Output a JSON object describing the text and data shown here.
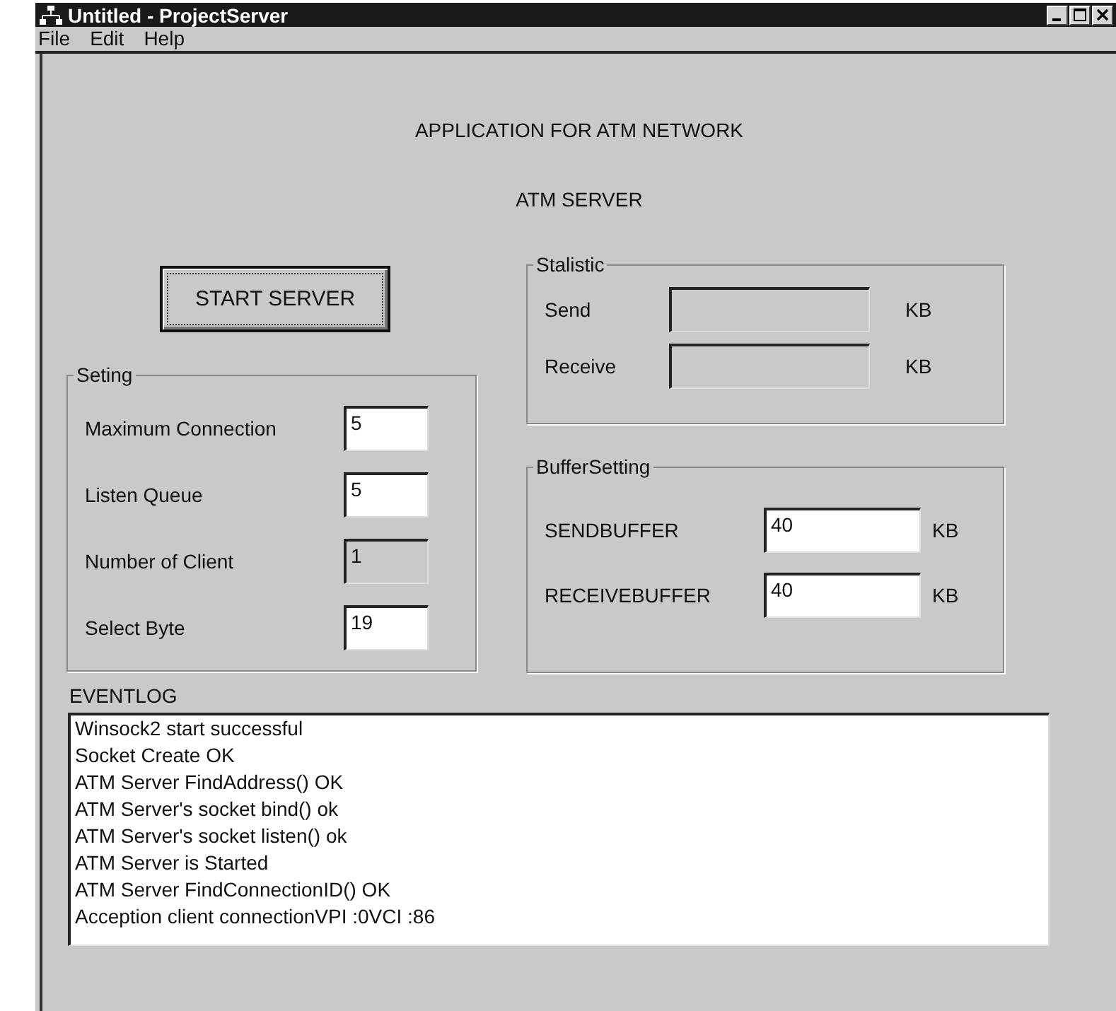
{
  "window": {
    "title": "Untitled - ProjectServer"
  },
  "menu": [
    {
      "label": "File"
    },
    {
      "label": "Edit"
    },
    {
      "label": "Help"
    }
  ],
  "heading": "APPLICATION FOR ATM NETWORK",
  "subheading": "ATM SERVER",
  "start_button": "START SERVER",
  "setting": {
    "title": "Seting",
    "rows": [
      {
        "label": "Maximum Connection",
        "value": "5",
        "disabled": false
      },
      {
        "label": "Listen Queue",
        "value": "5",
        "disabled": false
      },
      {
        "label": "Number of Client",
        "value": "1",
        "disabled": true
      },
      {
        "label": "Select Byte",
        "value": "19",
        "disabled": false
      }
    ]
  },
  "statistic": {
    "title": "Stalistic",
    "rows": [
      {
        "label": "Send",
        "value": "",
        "disabled": true,
        "unit": "KB"
      },
      {
        "label": "Receive",
        "value": "",
        "disabled": true,
        "unit": "KB"
      }
    ]
  },
  "buffer": {
    "title": "BufferSetting",
    "rows": [
      {
        "label": "SENDBUFFER",
        "value": "40",
        "disabled": false,
        "unit": "KB"
      },
      {
        "label": "RECEIVEBUFFER",
        "value": "40",
        "disabled": false,
        "unit": "KB"
      }
    ]
  },
  "eventlog": {
    "label": "EVENTLOG",
    "lines": [
      "Winsock2 start successful",
      "Socket Create OK",
      "ATM Server FindAddress() OK",
      "ATM Server's socket bind() ok",
      "ATM Server's socket listen() ok",
      "ATM Server is Started",
      "ATM Server FindConnectionID() OK",
      "Acception client connectionVPI :0VCI :86"
    ]
  }
}
